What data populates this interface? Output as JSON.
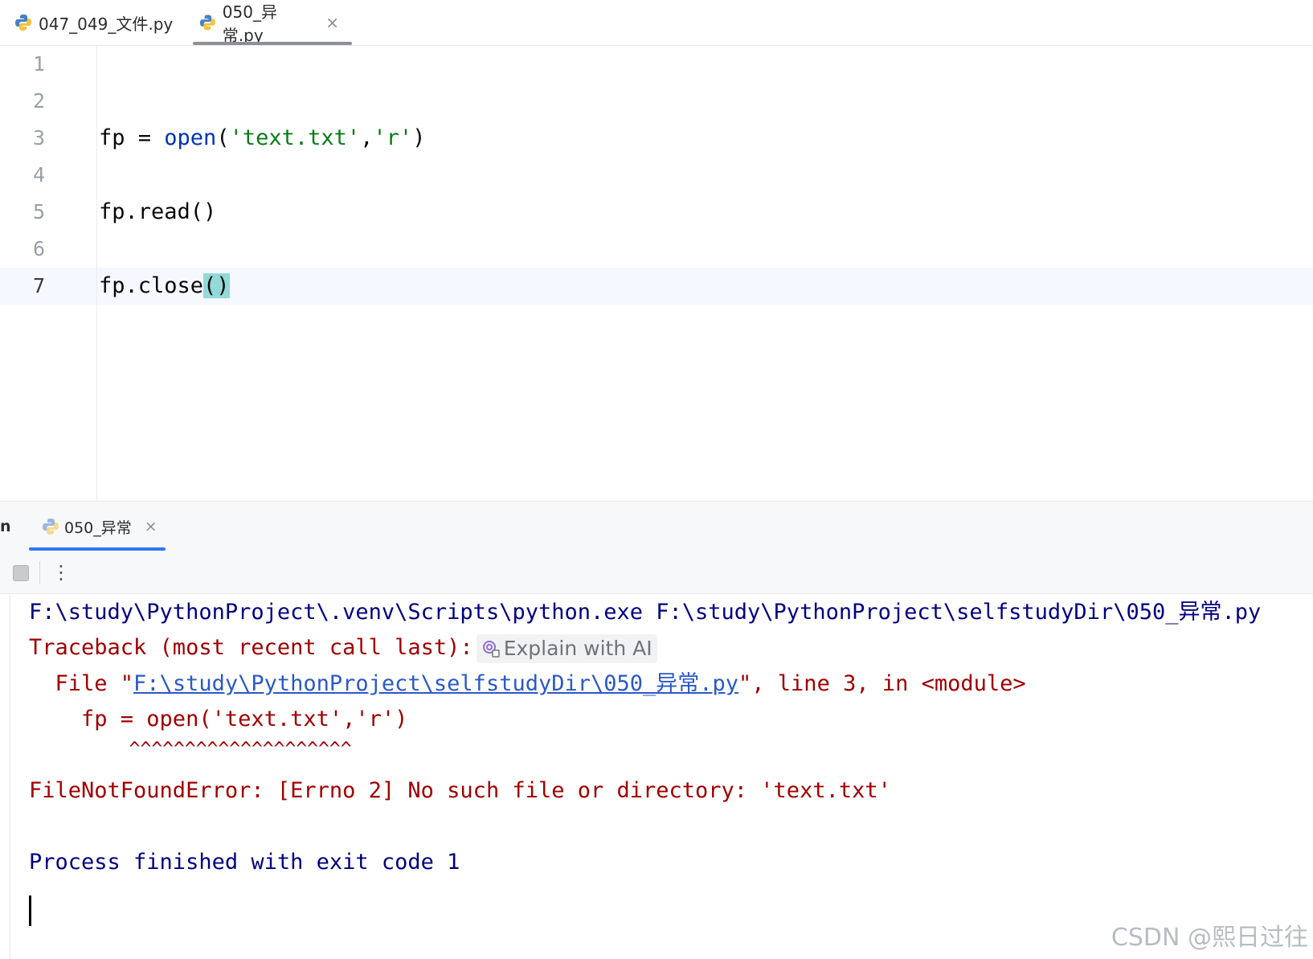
{
  "editor_tabs": [
    {
      "label": "047_049_文件.py",
      "active": false
    },
    {
      "label": "050_异常.py",
      "active": true,
      "close": "×"
    }
  ],
  "editor": {
    "line_numbers": [
      "1",
      "2",
      "3",
      "4",
      "5",
      "6",
      "7"
    ],
    "current_line": 7,
    "code": {
      "line3": {
        "var": "fp = ",
        "func": "open",
        "open_paren": "(",
        "s1": "'text.txt'",
        "comma": ",",
        "s2": "'r'",
        "close_paren": ")"
      },
      "line5": "fp.read()",
      "line7": {
        "text": "fp.close",
        "paren": "()"
      }
    }
  },
  "run_panel": {
    "left_label": "n",
    "tab_label": "050_异常",
    "tab_close": "×",
    "more_icon": "⋮"
  },
  "console": {
    "cmd": "F:\\study\\PythonProject\\.venv\\Scripts\\python.exe F:\\study\\PythonProject\\selfstudyDir\\050_异常.py",
    "traceback": "Traceback (most recent call last):",
    "explain_ai": "Explain with AI",
    "file_prefix": "  File \"",
    "file_link": "F:\\study\\PythonProject\\selfstudyDir\\050_异常.py",
    "file_suffix": "\", line 3, in <module>",
    "src_line": "    fp = open('text.txt','r')",
    "carets": "         ^^^^^^^^^^^^^^^^^^^^",
    "error": "FileNotFoundError: [Errno 2] No such file or directory: 'text.txt'",
    "finished": "Process finished with exit code 1"
  },
  "watermark": "CSDN @熙日过往",
  "colors": {
    "string": "#067d17",
    "keyword": "#0033b3",
    "error": "#a00000",
    "console_blue": "#000080",
    "link": "#2a59c8",
    "accent": "#3574f0"
  }
}
